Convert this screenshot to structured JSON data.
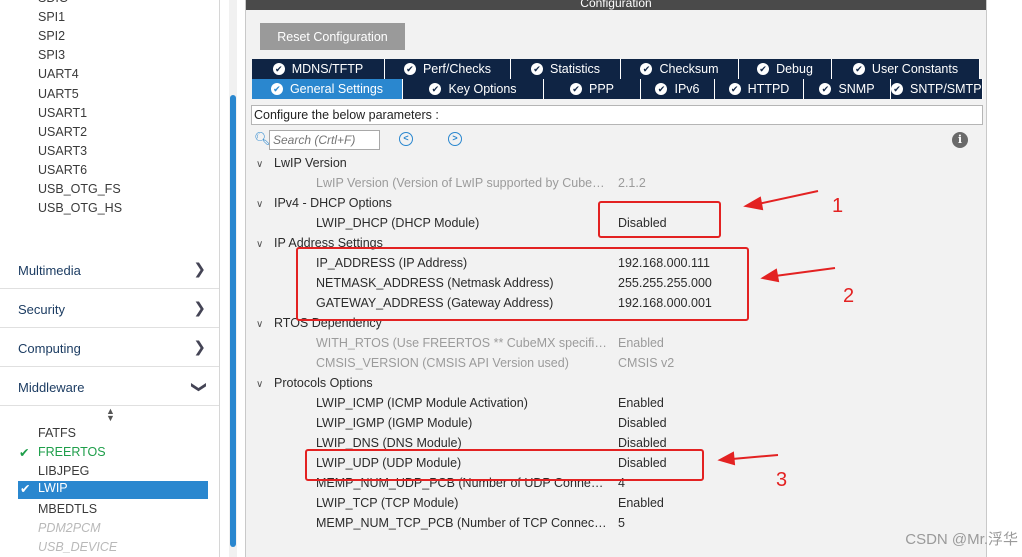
{
  "sidebar": {
    "top_items": [
      {
        "label": "SDIO",
        "state": "normal"
      },
      {
        "label": "SPI1",
        "state": "normal"
      },
      {
        "label": "SPI2",
        "state": "normal"
      },
      {
        "label": "SPI3",
        "state": "normal"
      },
      {
        "label": "UART4",
        "state": "normal"
      },
      {
        "label": "UART5",
        "state": "normal"
      },
      {
        "label": "USART1",
        "state": "normal"
      },
      {
        "label": "USART2",
        "state": "normal"
      },
      {
        "label": "USART3",
        "state": "normal"
      },
      {
        "label": "USART6",
        "state": "normal"
      },
      {
        "label": "USB_OTG_FS",
        "state": "normal"
      },
      {
        "label": "USB_OTG_HS",
        "state": "normal"
      }
    ],
    "categories": [
      {
        "label": "Multimedia",
        "chevron": "chevron-right-icon"
      },
      {
        "label": "Security",
        "chevron": "chevron-right-icon"
      },
      {
        "label": "Computing",
        "chevron": "chevron-right-icon"
      },
      {
        "label": "Middleware",
        "chevron": "chevron-down-icon"
      }
    ],
    "middleware_items": [
      {
        "label": "FATFS",
        "state": "normal"
      },
      {
        "label": "FREERTOS",
        "state": "checked"
      },
      {
        "label": "LIBJPEG",
        "state": "normal"
      },
      {
        "label": "LWIP",
        "state": "selected"
      },
      {
        "label": "MBEDTLS",
        "state": "normal"
      },
      {
        "label": "PDM2PCM",
        "state": "disabled"
      },
      {
        "label": "USB_DEVICE",
        "state": "disabled"
      }
    ],
    "check_glyph": "✔"
  },
  "main": {
    "title": "Configuration",
    "reset_button": "Reset Configuration",
    "tabs_row1": [
      "MDNS/TFTP",
      "Perf/Checks",
      "Statistics",
      "Checksum",
      "Debug",
      "User Constants"
    ],
    "tabs_row2": [
      "General Settings",
      "Key Options",
      "PPP",
      "IPv6",
      "HTTPD",
      "SNMP",
      "SNTP/SMTP"
    ],
    "active_tab": "General Settings",
    "params_label": "Configure the below parameters :",
    "search_placeholder": "Search (Crtl+F)",
    "info_glyph": "i",
    "groups": [
      {
        "title": "LwIP Version",
        "params": [
          {
            "name": "LwIP Version (Version of LwIP supported by Cube…",
            "value": "2.1.2",
            "readonly": true
          }
        ]
      },
      {
        "title": "IPv4 - DHCP Options",
        "params": [
          {
            "name": "LWIP_DHCP (DHCP Module)",
            "value": "Disabled",
            "readonly": false
          }
        ]
      },
      {
        "title": "IP Address Settings",
        "params": [
          {
            "name": "IP_ADDRESS (IP Address)",
            "value": "192.168.000.111",
            "readonly": false
          },
          {
            "name": "NETMASK_ADDRESS (Netmask Address)",
            "value": "255.255.255.000",
            "readonly": false
          },
          {
            "name": "GATEWAY_ADDRESS (Gateway Address)",
            "value": "192.168.000.001",
            "readonly": false
          }
        ]
      },
      {
        "title": "RTOS Dependency",
        "params": [
          {
            "name": "WITH_RTOS (Use FREERTOS ** CubeMX specifi…",
            "value": "Enabled",
            "readonly": true
          },
          {
            "name": "CMSIS_VERSION (CMSIS API Version used)",
            "value": "CMSIS v2",
            "readonly": true
          }
        ]
      },
      {
        "title": "Protocols Options",
        "params": [
          {
            "name": "LWIP_ICMP (ICMP Module Activation)",
            "value": "Enabled",
            "readonly": false
          },
          {
            "name": "LWIP_IGMP (IGMP Module)",
            "value": "Disabled",
            "readonly": false
          },
          {
            "name": "LWIP_DNS (DNS Module)",
            "value": "Disabled",
            "readonly": false
          },
          {
            "name": "LWIP_UDP (UDP Module)",
            "value": "Disabled",
            "readonly": false
          },
          {
            "name": "MEMP_NUM_UDP_PCB (Number of UDP Conne…",
            "value": "4",
            "readonly": false
          },
          {
            "name": "LWIP_TCP (TCP Module)",
            "value": "Enabled",
            "readonly": false
          },
          {
            "name": "MEMP_NUM_TCP_PCB (Number of TCP Connec…",
            "value": "5",
            "readonly": false
          }
        ]
      }
    ]
  },
  "annotations": {
    "numbers": [
      "1",
      "2",
      "3"
    ],
    "color": "#e32222"
  },
  "watermark": "CSDN @Mr.浮华",
  "colors": {
    "accent_blue": "#2a87cf",
    "tab_dark": "#0f2444",
    "check_green": "#1e9e4a",
    "annotation_red": "#e32222"
  }
}
